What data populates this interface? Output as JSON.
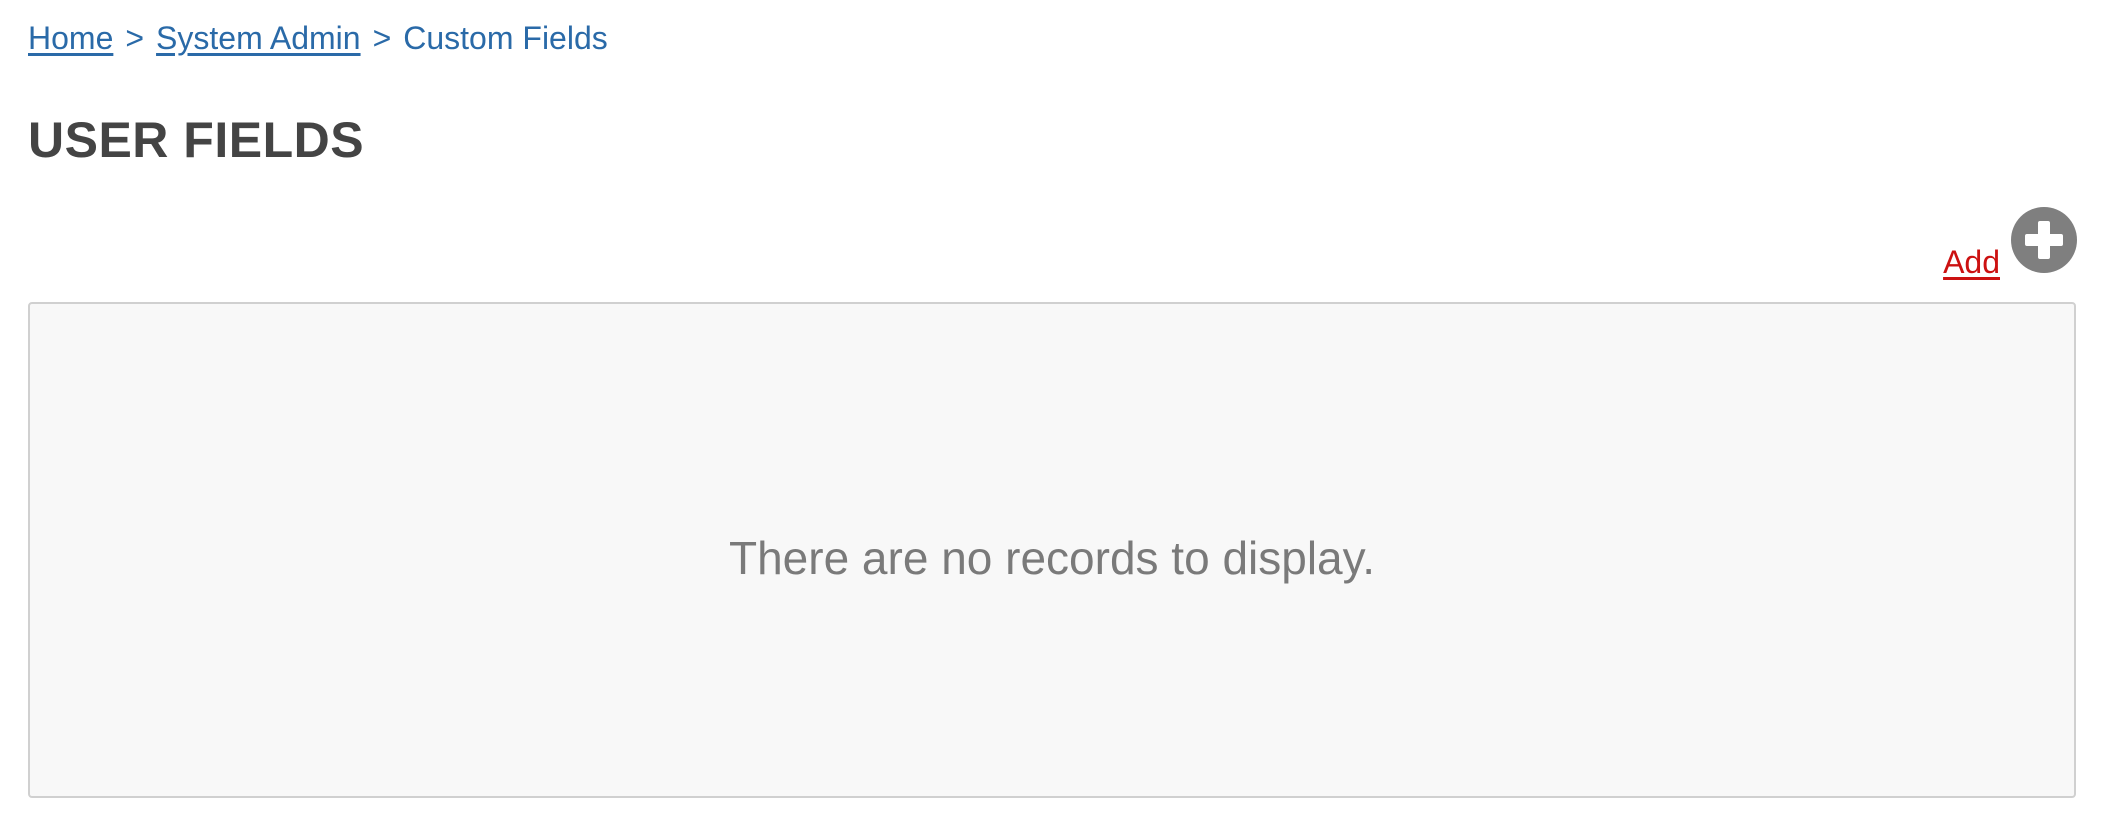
{
  "breadcrumb": {
    "items": [
      {
        "label": "Home"
      },
      {
        "label": "System Admin"
      },
      {
        "label": "Custom Fields"
      }
    ],
    "separator": ">"
  },
  "page": {
    "title": "USER FIELDS"
  },
  "toolbar": {
    "add_label": "Add",
    "add_icon": "plus-circle-icon"
  },
  "records": {
    "empty_message": "There are no records to display."
  },
  "colors": {
    "link": "#2a6aa8",
    "add_link": "#cc1111",
    "title": "#444444",
    "panel_bg": "#f8f8f8",
    "icon_gray": "#7f7f7f"
  }
}
